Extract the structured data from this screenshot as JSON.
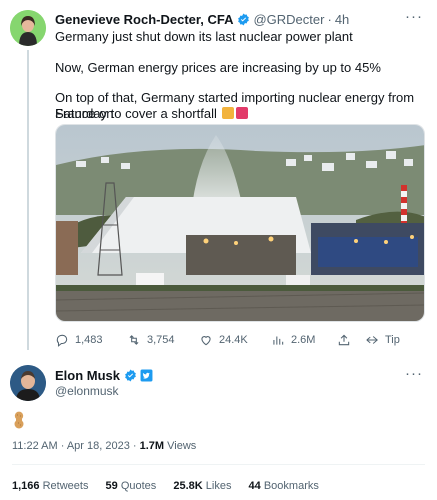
{
  "quoted_tweet": {
    "author_name": "Genevieve Roch-Decter, CFA",
    "handle": "@GRDecter",
    "separator": "·",
    "time": "4h",
    "more_label": "···",
    "lines": [
      "Germany just shut down its last nuclear power plant",
      "Now, German energy prices are increasing by up to 45%",
      "On top of that, Germany started importing nuclear energy from France on",
      "Saturday to cover a shortfall"
    ],
    "actions": {
      "replies": "1,483",
      "retweets": "3,754",
      "likes": "24.4K",
      "views": "2.6M",
      "tip": "Tip"
    }
  },
  "main_tweet": {
    "author_name": "Elon Musk",
    "handle": "@elonmusk",
    "more_label": "···",
    "content_icon": "peanut-emoji",
    "timestamp": "11:22 AM · Apr 18, 2023 · ",
    "views_count": "1.7M",
    "views_label": " Views",
    "stats": {
      "retweets_count": "1,166",
      "retweets_label": " Retweets",
      "quotes_count": "59",
      "quotes_label": " Quotes",
      "likes_count": "25.8K",
      "likes_label": " Likes",
      "bookmarks_count": "44",
      "bookmarks_label": " Bookmarks"
    }
  },
  "colors": {
    "verified_blue": "#1d9bf0",
    "muted_text": "#536471"
  }
}
